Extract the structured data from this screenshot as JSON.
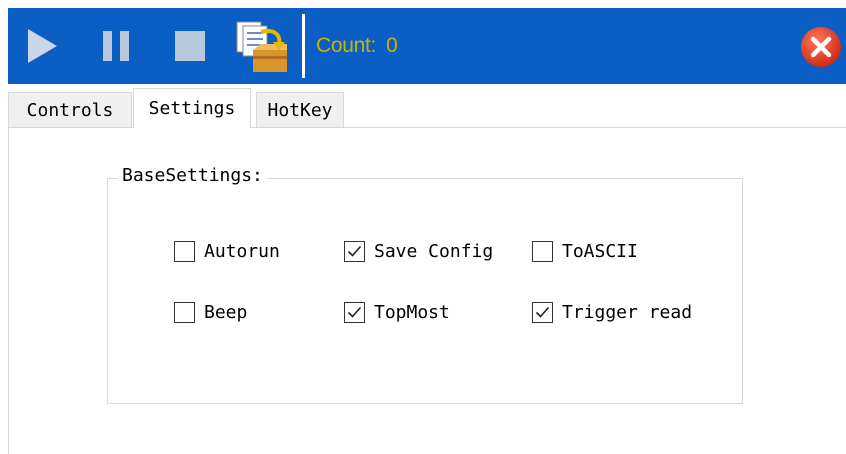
{
  "toolbar": {
    "background_color": "#0a5ec4",
    "buttons": [
      {
        "name": "play",
        "icon": "play-icon",
        "color": "#c9d6e6"
      },
      {
        "name": "pause",
        "icon": "pause-icon",
        "color": "#b9c8da"
      },
      {
        "name": "stop",
        "icon": "stop-icon",
        "color": "#b9c8da"
      },
      {
        "name": "export",
        "icon": "export-folder-icon"
      }
    ],
    "count_label": "Count:",
    "count_value": "0",
    "count_color": "#c8b400",
    "close_icon": "close-icon",
    "close_color": "#e8412c"
  },
  "tabs": [
    {
      "label": "Controls",
      "selected": false
    },
    {
      "label": "Settings",
      "selected": true
    },
    {
      "label": "HotKey",
      "selected": false
    }
  ],
  "settings": {
    "group_title": "BaseSettings:",
    "options": [
      {
        "label": "Autorun",
        "checked": false
      },
      {
        "label": "Save Config",
        "checked": true
      },
      {
        "label": "ToASCII",
        "checked": false
      },
      {
        "label": "Beep",
        "checked": false
      },
      {
        "label": "TopMost",
        "checked": true
      },
      {
        "label": "Trigger read",
        "checked": true
      }
    ]
  }
}
